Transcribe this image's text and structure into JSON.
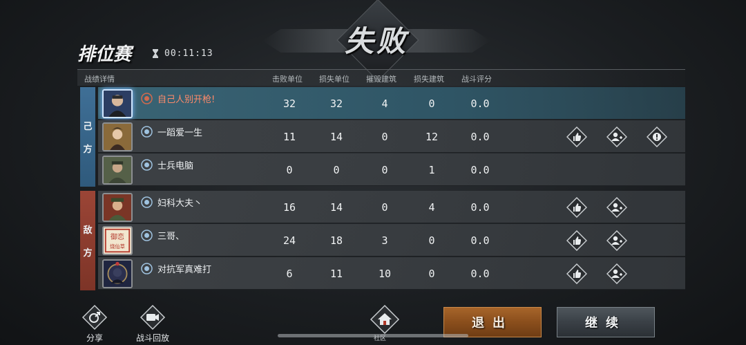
{
  "header": {
    "result": "失败",
    "mode": "排位赛",
    "timer": "00:11:13"
  },
  "table": {
    "section_label": "战绩详情",
    "columns": [
      "击败单位",
      "损失单位",
      "摧毁建筑",
      "损失建筑",
      "战斗评分"
    ]
  },
  "teams": {
    "ally_label_1": "己",
    "ally_label_2": "方",
    "enemy_label_1": "敌",
    "enemy_label_2": "方"
  },
  "players": [
    {
      "name": "自己人别开枪!",
      "stats": [
        "32",
        "32",
        "4",
        "0",
        "0.0"
      ]
    },
    {
      "name": "一蹈爱一生",
      "stats": [
        "11",
        "14",
        "0",
        "12",
        "0.0"
      ]
    },
    {
      "name": "士兵电脑",
      "stats": [
        "0",
        "0",
        "0",
        "1",
        "0.0"
      ]
    },
    {
      "name": "妇科大夫丶",
      "stats": [
        "16",
        "14",
        "0",
        "4",
        "0.0"
      ]
    },
    {
      "name": "三哥、",
      "stats": [
        "24",
        "18",
        "3",
        "0",
        "0.0"
      ]
    },
    {
      "name": "对抗军真难打",
      "stats": [
        "6",
        "11",
        "10",
        "0",
        "0.0"
      ]
    }
  ],
  "avatar_text": {
    "line1": "御恋",
    "line2": "烧仙草"
  },
  "bottom": {
    "share": "分享",
    "replay": "战斗回放",
    "community": "社区",
    "exit": "退出",
    "continue": "继续"
  },
  "colors": {
    "ally": "#3f6f96",
    "enemy": "#9b4536",
    "self_row": "#3a6475",
    "self_name": "#ff8a6a",
    "exit_button": "#8a4e1c",
    "continue_button": "#3a4046"
  },
  "icons": [
    "hourglass-icon",
    "rank-badge-icon",
    "like-icon",
    "add-friend-icon",
    "report-icon",
    "share-icon",
    "replay-icon",
    "home-icon"
  ]
}
